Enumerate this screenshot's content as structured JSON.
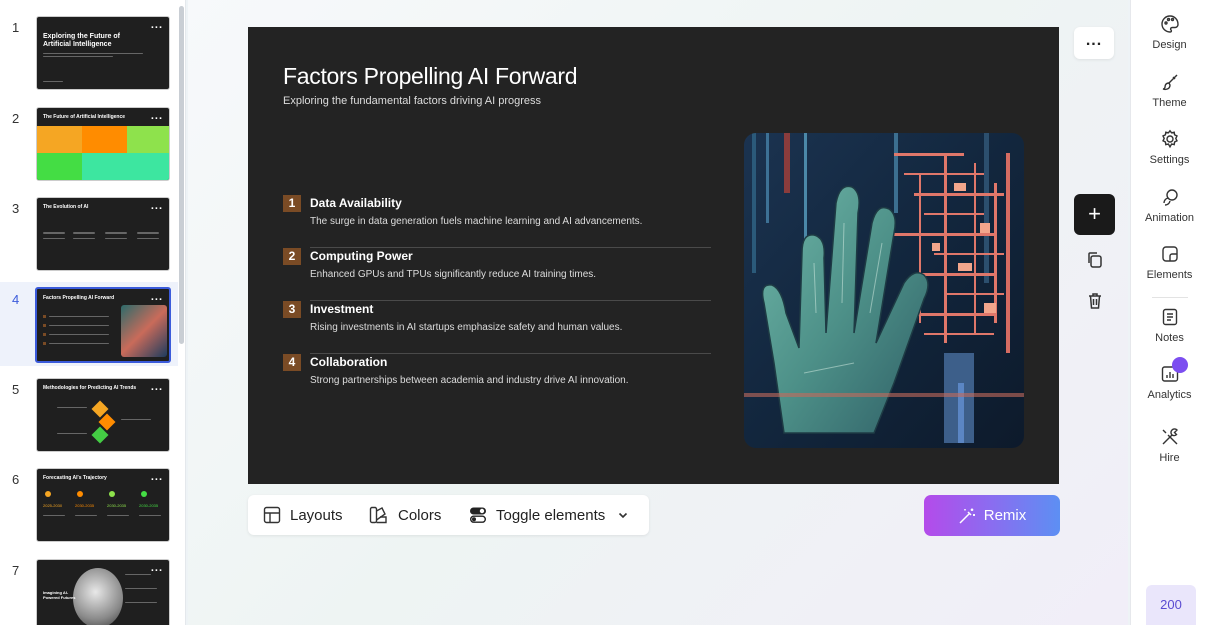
{
  "sidebar": {
    "thumbnails": [
      {
        "num": "1",
        "title": "Exploring the Future of Artificial Intelligence"
      },
      {
        "num": "2",
        "title": "The Future of Artificial Intelligence"
      },
      {
        "num": "3",
        "title": "The Evolution of AI"
      },
      {
        "num": "4",
        "title": "Factors Propelling AI Forward"
      },
      {
        "num": "5",
        "title": "Methodologies for Predicting AI Trends"
      },
      {
        "num": "6",
        "title": "Forecasting AI's Trajectory",
        "years": [
          "2025-2030",
          "2030-2035",
          "2030-2035",
          "2030-2035"
        ]
      },
      {
        "num": "7",
        "title": "Imagining AI-Powered Futures"
      }
    ],
    "menu_dots": "..."
  },
  "slide": {
    "title": "Factors Propelling AI Forward",
    "subtitle": "Exploring the fundamental factors driving AI progress",
    "items": [
      {
        "num": "1",
        "title": "Data Availability",
        "desc": "The surge in data generation fuels machine learning and AI advancements."
      },
      {
        "num": "2",
        "title": "Computing Power",
        "desc": "Enhanced GPUs and TPUs significantly reduce AI training times."
      },
      {
        "num": "3",
        "title": "Investment",
        "desc": "Rising investments in AI startups emphasize safety and human values."
      },
      {
        "num": "4",
        "title": "Collaboration",
        "desc": "Strong partnerships between academia and industry drive AI innovation."
      }
    ]
  },
  "toolbar": {
    "layouts": "Layouts",
    "colors": "Colors",
    "toggle": "Toggle elements",
    "remix": "Remix",
    "more": "...",
    "add": "+"
  },
  "right_panel": {
    "items": [
      "Design",
      "Theme",
      "Settings",
      "Animation",
      "Elements",
      "Notes",
      "Analytics",
      "Hire"
    ],
    "credits": "200"
  },
  "colors": {
    "slide_bg": "#232323",
    "number_badge": "#7a4b25",
    "accent_blue": "#3b5bdb",
    "remix_gradient_start": "#b44bea",
    "remix_gradient_end": "#5d8ff3"
  }
}
